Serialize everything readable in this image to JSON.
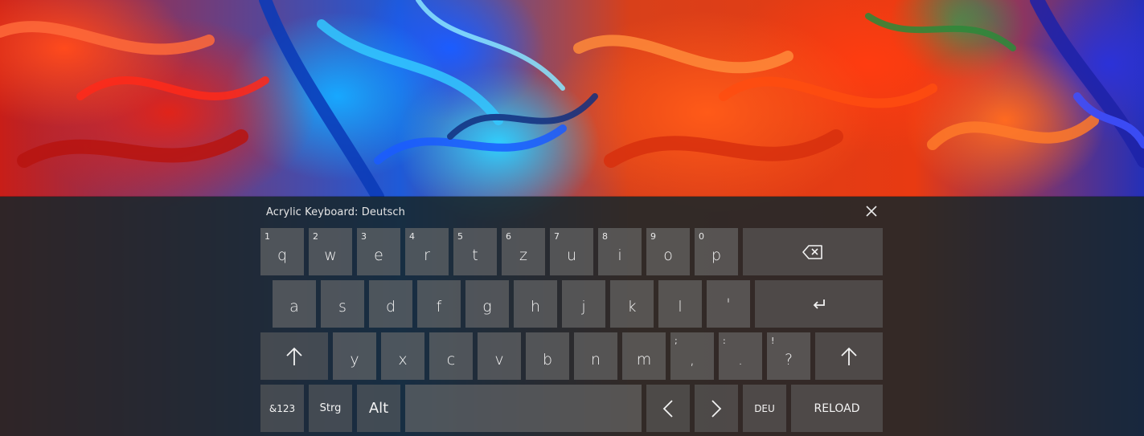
{
  "keyboard": {
    "title": "Acrylic Keyboard: Deutsch",
    "close_icon": "close-icon",
    "row1": [
      {
        "key": "q",
        "hint": "1"
      },
      {
        "key": "w",
        "hint": "2"
      },
      {
        "key": "e",
        "hint": "3"
      },
      {
        "key": "r",
        "hint": "4"
      },
      {
        "key": "t",
        "hint": "5"
      },
      {
        "key": "z",
        "hint": "6"
      },
      {
        "key": "u",
        "hint": "7"
      },
      {
        "key": "i",
        "hint": "8"
      },
      {
        "key": "o",
        "hint": "9"
      },
      {
        "key": "p",
        "hint": "0"
      }
    ],
    "row2": [
      "a",
      "s",
      "d",
      "f",
      "g",
      "h",
      "j",
      "k",
      "l",
      "'"
    ],
    "row3": [
      {
        "key": "y",
        "hint": ""
      },
      {
        "key": "x",
        "hint": ""
      },
      {
        "key": "c",
        "hint": ""
      },
      {
        "key": "v",
        "hint": ""
      },
      {
        "key": "b",
        "hint": ""
      },
      {
        "key": "n",
        "hint": ""
      },
      {
        "key": "m",
        "hint": ""
      },
      {
        "key": ",",
        "hint": ";"
      },
      {
        "key": ".",
        "hint": ":"
      },
      {
        "key": "?",
        "hint": "!"
      }
    ],
    "row4": {
      "symbols": "&123",
      "ctrl": "Strg",
      "alt": "Alt",
      "space": "",
      "language": "DEU",
      "reload": "RELOAD"
    },
    "icons": {
      "backspace": "backspace-icon",
      "enter": "enter-icon",
      "shift": "shift-icon",
      "left": "chevron-left-icon",
      "right": "chevron-right-icon"
    }
  }
}
